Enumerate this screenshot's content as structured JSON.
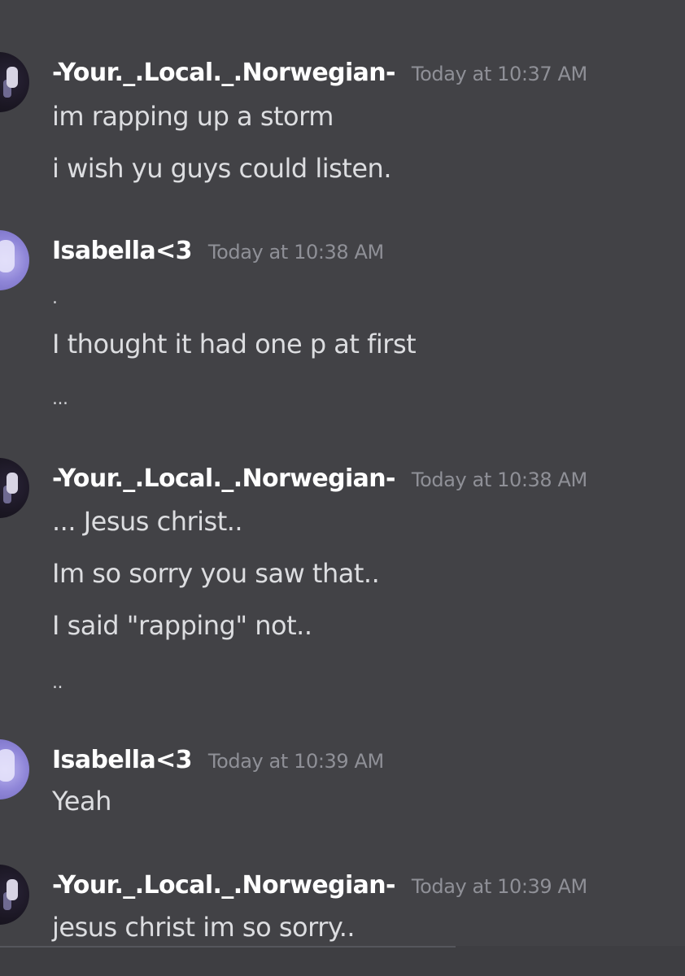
{
  "messages": [
    {
      "username": "-Your._.Local._.Norwegian-",
      "timestamp": "Today at 10:37 AM",
      "lines": [
        "im rapping up a storm",
        "i wish yu guys could listen."
      ]
    },
    {
      "username": "Isabella<3",
      "timestamp": "Today at 10:38 AM",
      "lines": [
        ".",
        "I thought it had one p at first",
        "..."
      ]
    },
    {
      "username": "-Your._.Local._.Norwegian-",
      "timestamp": "Today at 10:38 AM",
      "lines": [
        "... Jesus christ..",
        "Im so sorry you saw that..",
        "I said \"rapping\" not..",
        ".."
      ]
    },
    {
      "username": "Isabella<3",
      "timestamp": "Today at 10:39 AM",
      "lines": [
        "Yeah"
      ]
    },
    {
      "username": "-Your._.Local._.Norwegian-",
      "timestamp": "Today at 10:39 AM",
      "lines": [
        "jesus christ im so sorry.."
      ]
    }
  ],
  "colors": {
    "background": "#424246",
    "username": "#ffffff",
    "timestamp": "#8f9097",
    "message_text": "#dcdde0",
    "username_highlight": "#7d6a1e"
  },
  "icons": [
    "avatar-norwegian",
    "avatar-isabella"
  ]
}
